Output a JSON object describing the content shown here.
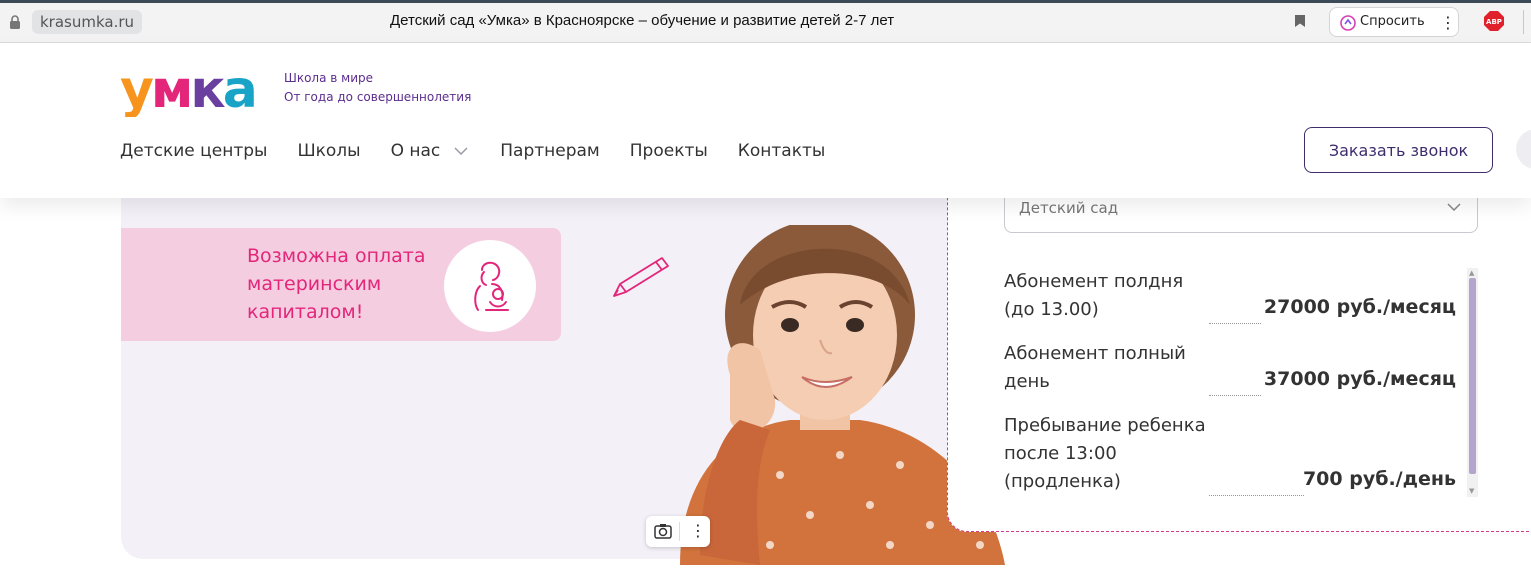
{
  "browser": {
    "url": "krasumka.ru",
    "title": "Детский сад «Умка» в Красноярске – обучение и развитие детей 2-7 лет",
    "ask_label": "Спросить",
    "extension_icon": "adblock-icon"
  },
  "header": {
    "logo_text": "умка",
    "tagline_line1": "Школа в мире",
    "tagline_line2": "От года до совершеннолетия",
    "nav": [
      {
        "label": "Детские центры"
      },
      {
        "label": "Школы"
      },
      {
        "label": "О нас"
      },
      {
        "label": "Партнерам"
      },
      {
        "label": "Проекты"
      },
      {
        "label": "Контакты"
      }
    ],
    "call_button": "Заказать звонок"
  },
  "hero": {
    "banner_text_line1": "Возможна оплата",
    "banner_text_line2": "материнским",
    "banner_text_line3": "капиталом!"
  },
  "prices": {
    "select_value": "Детский сад",
    "rows": [
      {
        "name_line1": "Абонемент полдня",
        "name_line2": "(до 13.00)",
        "name_line3": "",
        "value": "27000 руб./месяц"
      },
      {
        "name_line1": "Абонемент полный",
        "name_line2": "день",
        "name_line3": "",
        "value": "37000 руб./месяц"
      },
      {
        "name_line1": "Пребывание ребенка",
        "name_line2": "после 13:00",
        "name_line3": "(продленка)",
        "value": "700 руб./день"
      }
    ]
  },
  "colors": {
    "brand_purple": "#3f2d6b",
    "accent_pink": "#e4267b",
    "banner_pink": "#f4cde0"
  }
}
